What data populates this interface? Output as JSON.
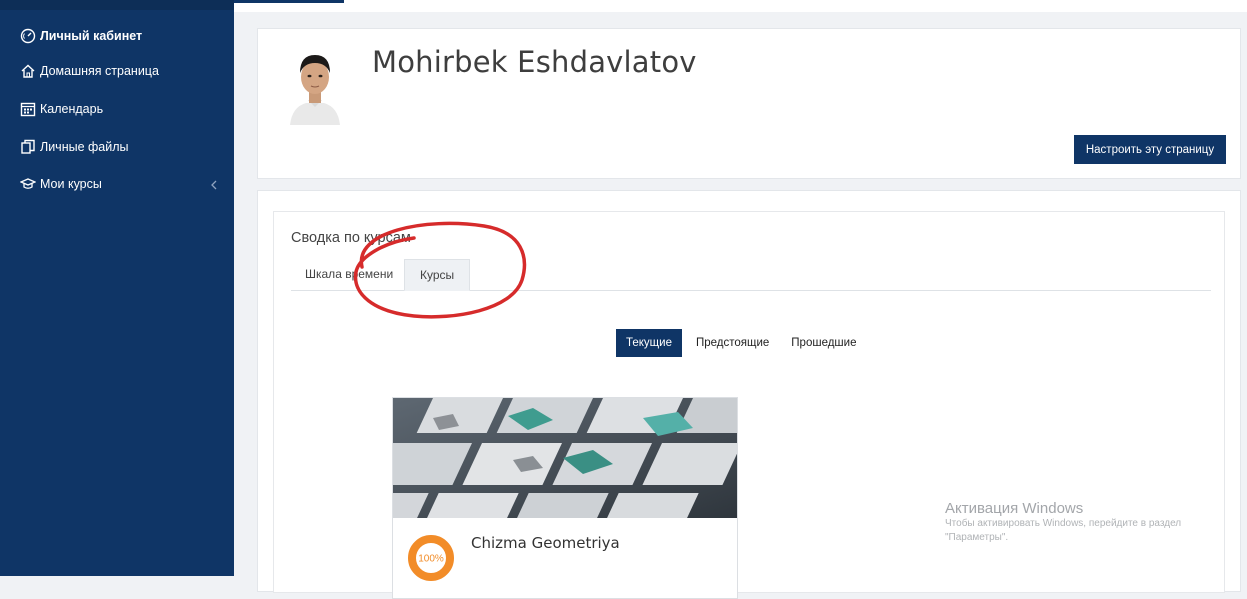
{
  "sidebar": {
    "items": [
      {
        "label": "Личный кабинет",
        "icon": "dashboard-icon"
      },
      {
        "label": "Домашняя страница",
        "icon": "home-icon"
      },
      {
        "label": "Календарь",
        "icon": "calendar-icon"
      },
      {
        "label": "Личные файлы",
        "icon": "files-icon"
      },
      {
        "label": "Мои курсы",
        "icon": "graduation-cap-icon"
      }
    ]
  },
  "header": {
    "user_name": "Mohirbek Eshdavlatov",
    "customise_label": "Настроить эту страницу"
  },
  "course_overview": {
    "title": "Сводка по курсам",
    "tabs": [
      "Шкала времени",
      "Курсы"
    ],
    "active_tab": "Курсы",
    "filters": [
      "Текущие",
      "Предстоящие",
      "Прошедшие"
    ],
    "active_filter": "Текущие",
    "courses": [
      {
        "name": "Chizma Geometriya",
        "progress_label": "100%",
        "progress": 100
      }
    ]
  },
  "watermark": {
    "title": "Активация Windows",
    "line1": "Чтобы активировать Windows, перейдите в раздел",
    "line2": "\"Параметры\"."
  },
  "colors": {
    "sidebar_bg": "#0f3566",
    "accent": "#0f3566",
    "progress": "#f28c28",
    "highlight": "#d62b2b"
  }
}
